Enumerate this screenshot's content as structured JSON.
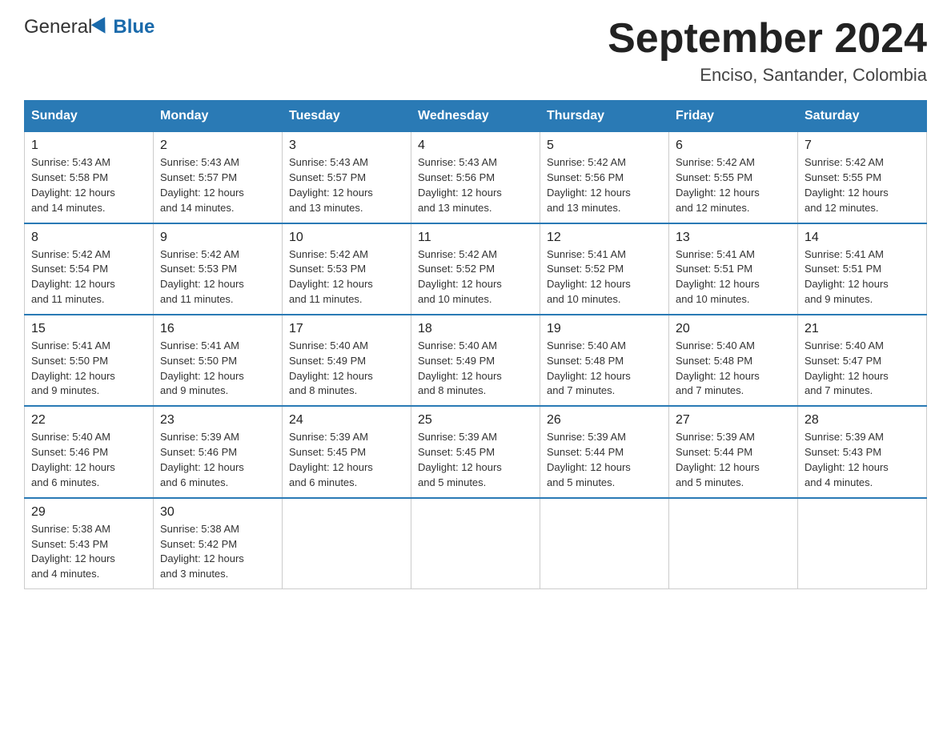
{
  "logo": {
    "general": "General",
    "blue": "Blue"
  },
  "title": {
    "month": "September 2024",
    "location": "Enciso, Santander, Colombia"
  },
  "weekdays": [
    "Sunday",
    "Monday",
    "Tuesday",
    "Wednesday",
    "Thursday",
    "Friday",
    "Saturday"
  ],
  "weeks": [
    [
      {
        "day": "1",
        "sunrise": "5:43 AM",
        "sunset": "5:58 PM",
        "daylight": "12 hours and 14 minutes."
      },
      {
        "day": "2",
        "sunrise": "5:43 AM",
        "sunset": "5:57 PM",
        "daylight": "12 hours and 14 minutes."
      },
      {
        "day": "3",
        "sunrise": "5:43 AM",
        "sunset": "5:57 PM",
        "daylight": "12 hours and 13 minutes."
      },
      {
        "day": "4",
        "sunrise": "5:43 AM",
        "sunset": "5:56 PM",
        "daylight": "12 hours and 13 minutes."
      },
      {
        "day": "5",
        "sunrise": "5:42 AM",
        "sunset": "5:56 PM",
        "daylight": "12 hours and 13 minutes."
      },
      {
        "day": "6",
        "sunrise": "5:42 AM",
        "sunset": "5:55 PM",
        "daylight": "12 hours and 12 minutes."
      },
      {
        "day": "7",
        "sunrise": "5:42 AM",
        "sunset": "5:55 PM",
        "daylight": "12 hours and 12 minutes."
      }
    ],
    [
      {
        "day": "8",
        "sunrise": "5:42 AM",
        "sunset": "5:54 PM",
        "daylight": "12 hours and 11 minutes."
      },
      {
        "day": "9",
        "sunrise": "5:42 AM",
        "sunset": "5:53 PM",
        "daylight": "12 hours and 11 minutes."
      },
      {
        "day": "10",
        "sunrise": "5:42 AM",
        "sunset": "5:53 PM",
        "daylight": "12 hours and 11 minutes."
      },
      {
        "day": "11",
        "sunrise": "5:42 AM",
        "sunset": "5:52 PM",
        "daylight": "12 hours and 10 minutes."
      },
      {
        "day": "12",
        "sunrise": "5:41 AM",
        "sunset": "5:52 PM",
        "daylight": "12 hours and 10 minutes."
      },
      {
        "day": "13",
        "sunrise": "5:41 AM",
        "sunset": "5:51 PM",
        "daylight": "12 hours and 10 minutes."
      },
      {
        "day": "14",
        "sunrise": "5:41 AM",
        "sunset": "5:51 PM",
        "daylight": "12 hours and 9 minutes."
      }
    ],
    [
      {
        "day": "15",
        "sunrise": "5:41 AM",
        "sunset": "5:50 PM",
        "daylight": "12 hours and 9 minutes."
      },
      {
        "day": "16",
        "sunrise": "5:41 AM",
        "sunset": "5:50 PM",
        "daylight": "12 hours and 9 minutes."
      },
      {
        "day": "17",
        "sunrise": "5:40 AM",
        "sunset": "5:49 PM",
        "daylight": "12 hours and 8 minutes."
      },
      {
        "day": "18",
        "sunrise": "5:40 AM",
        "sunset": "5:49 PM",
        "daylight": "12 hours and 8 minutes."
      },
      {
        "day": "19",
        "sunrise": "5:40 AM",
        "sunset": "5:48 PM",
        "daylight": "12 hours and 7 minutes."
      },
      {
        "day": "20",
        "sunrise": "5:40 AM",
        "sunset": "5:48 PM",
        "daylight": "12 hours and 7 minutes."
      },
      {
        "day": "21",
        "sunrise": "5:40 AM",
        "sunset": "5:47 PM",
        "daylight": "12 hours and 7 minutes."
      }
    ],
    [
      {
        "day": "22",
        "sunrise": "5:40 AM",
        "sunset": "5:46 PM",
        "daylight": "12 hours and 6 minutes."
      },
      {
        "day": "23",
        "sunrise": "5:39 AM",
        "sunset": "5:46 PM",
        "daylight": "12 hours and 6 minutes."
      },
      {
        "day": "24",
        "sunrise": "5:39 AM",
        "sunset": "5:45 PM",
        "daylight": "12 hours and 6 minutes."
      },
      {
        "day": "25",
        "sunrise": "5:39 AM",
        "sunset": "5:45 PM",
        "daylight": "12 hours and 5 minutes."
      },
      {
        "day": "26",
        "sunrise": "5:39 AM",
        "sunset": "5:44 PM",
        "daylight": "12 hours and 5 minutes."
      },
      {
        "day": "27",
        "sunrise": "5:39 AM",
        "sunset": "5:44 PM",
        "daylight": "12 hours and 5 minutes."
      },
      {
        "day": "28",
        "sunrise": "5:39 AM",
        "sunset": "5:43 PM",
        "daylight": "12 hours and 4 minutes."
      }
    ],
    [
      {
        "day": "29",
        "sunrise": "5:38 AM",
        "sunset": "5:43 PM",
        "daylight": "12 hours and 4 minutes."
      },
      {
        "day": "30",
        "sunrise": "5:38 AM",
        "sunset": "5:42 PM",
        "daylight": "12 hours and 3 minutes."
      },
      null,
      null,
      null,
      null,
      null
    ]
  ],
  "labels": {
    "sunrise": "Sunrise:",
    "sunset": "Sunset:",
    "daylight": "Daylight:"
  }
}
